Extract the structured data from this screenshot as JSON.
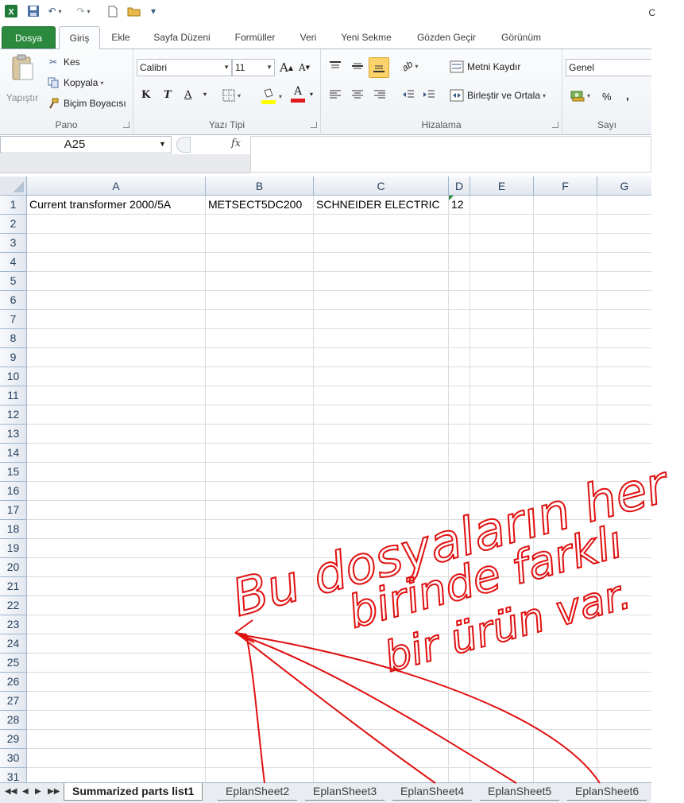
{
  "window": {
    "title": "C"
  },
  "tabs": [
    "Dosya",
    "Giriş",
    "Ekle",
    "Sayfa Düzeni",
    "Formüller",
    "Veri",
    "Yeni Sekme",
    "Gözden Geçir",
    "Görünüm"
  ],
  "ribbon": {
    "clipboard": {
      "label": "Pano",
      "paste": "Yapıştır",
      "cut": "Kes",
      "copy": "Kopyala",
      "format_painter": "Biçim Boyacısı"
    },
    "font": {
      "label": "Yazı Tipi",
      "font_name": "Calibri",
      "font_size": "11",
      "bold": "K",
      "italic": "T",
      "underline": "A",
      "font_color": "A"
    },
    "alignment": {
      "label": "Hizalama",
      "wrap_text": "Metni Kaydır",
      "merge_center": "Birleştir ve Ortala"
    },
    "number": {
      "label": "Sayı",
      "format": "Genel",
      "percent": "%",
      "comma": ","
    }
  },
  "formula_bar": {
    "name_box": "A25",
    "fx": "fx",
    "formula": ""
  },
  "grid": {
    "columns": [
      "A",
      "B",
      "C",
      "D",
      "E",
      "F",
      "G"
    ],
    "rows": [
      "1",
      "2",
      "3",
      "4",
      "5",
      "6",
      "7",
      "8",
      "9",
      "10",
      "11",
      "12",
      "13",
      "14",
      "15",
      "16",
      "17",
      "18",
      "19",
      "20",
      "21",
      "22",
      "23",
      "24",
      "25",
      "26",
      "27",
      "28",
      "29",
      "30",
      "31"
    ],
    "cells": {
      "A1": "Current transformer 2000/5A",
      "B1": "METSECT5DC200",
      "C1": "SCHNEIDER ELECTRIC",
      "D1": "12"
    }
  },
  "sheets": [
    "Summarized parts list1",
    "EplanSheet2",
    "EplanSheet3",
    "EplanSheet4",
    "EplanSheet5",
    "EplanSheet6"
  ],
  "annotation": {
    "text": "Bu dosyaların her birinde farklı bir ürün var.",
    "color": "#e01010"
  },
  "colors": {
    "file_tab": "#2b8a3e",
    "header_text": "#27415f"
  }
}
